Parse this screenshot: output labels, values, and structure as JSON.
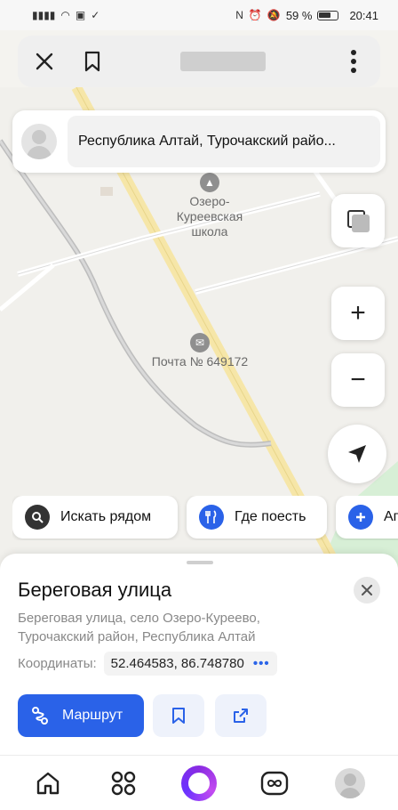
{
  "status_bar": {
    "battery_text": "59 %",
    "battery_level": 0.59,
    "time": "20:41",
    "icons": [
      "signal-icon",
      "wifi-icon",
      "hd-icon",
      "check-circle-icon",
      "nfc-icon",
      "alarm-icon",
      "mute-icon",
      "battery-icon"
    ]
  },
  "browser_bar": {
    "close_icon": "close-icon",
    "bookmark_icon": "bookmark-icon",
    "menu_icon": "more-vert-icon"
  },
  "search": {
    "text": "Республика Алтай, Турочакский райо..."
  },
  "map": {
    "pois": [
      {
        "name": "school",
        "label_lines": [
          "Озеро-",
          "Куреевская",
          "школа"
        ],
        "icon": "school-icon"
      },
      {
        "name": "post",
        "label_lines": [
          "Почта № 649172"
        ],
        "icon": "mail-icon"
      }
    ],
    "controls": {
      "layers": "layers-icon",
      "zoom_in": "+",
      "zoom_out": "−",
      "locate": "location-arrow-icon"
    }
  },
  "chips": [
    {
      "label": "Искать рядом",
      "icon": "search-icon",
      "color": "#333333"
    },
    {
      "label": "Где поесть",
      "icon": "fork-knife-icon",
      "color": "#2a62e8"
    },
    {
      "label": "Ап",
      "icon": "plus-icon",
      "color": "#2a62e8"
    }
  ],
  "sheet": {
    "title": "Береговая улица",
    "address": "Береговая улица, село Озеро-Куреево, Турочакский район, Республика Алтай",
    "coords_label": "Координаты:",
    "coords_value": "52.464583, 86.748780",
    "coords_more": "•••",
    "route_label": "Маршрут"
  },
  "bottom_nav": [
    "home-icon",
    "services-grid-icon",
    "alice-icon",
    "infinity-icon",
    "profile-avatar"
  ]
}
